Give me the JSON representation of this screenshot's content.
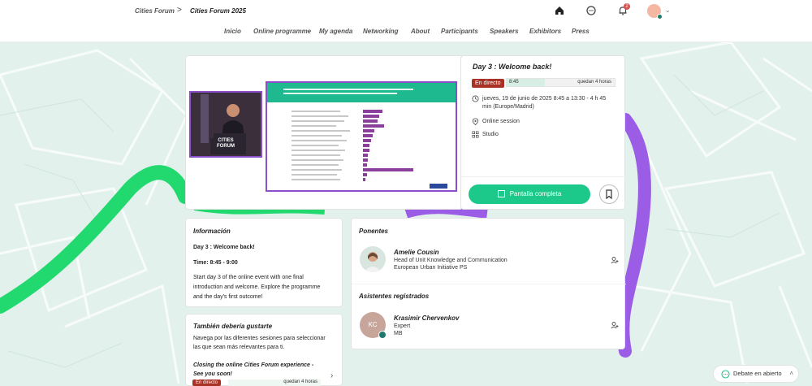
{
  "header": {
    "breadcrumb_parent": "Cities Forum",
    "breadcrumb_sep": ">",
    "breadcrumb_current": "Cities Forum 2025",
    "notification_count": "2",
    "nav": [
      "Inicio",
      "Online programme",
      "My agenda",
      "Networking",
      "About",
      "Participants",
      "Speakers",
      "Exhibitors",
      "Press"
    ]
  },
  "event": {
    "title": "Day 3 : Welcome back!",
    "live_label": "En directo",
    "start": "8:45",
    "remaining": "quedan 4 horas",
    "progress": 0.35,
    "date_line1": "jueves, 19 de junio de 2025 8:45 a 13:30 - 4 h 45",
    "date_line2": "min (Europe/Madrid)",
    "session_type": "Online session",
    "room": "Studio",
    "fullscreen_label": "Pantalla completa"
  },
  "information": {
    "title": "Información",
    "line1": "Day 3 : Welcome back!",
    "line2": "Time: 8:45 - 9:00",
    "body1": "Start day 3 of the online event with one final",
    "body2": "introduction and welcome. Explore the programme",
    "body3": "and the day's first outcome!"
  },
  "also_like": {
    "title": "También debería gustarte",
    "desc1": "Navega por las diferentes sesiones para seleccionar",
    "desc2": "las que sean más relevantes para ti.",
    "item_title1": "Closing the online Cities Forum experience -",
    "item_title2": "See you soon!",
    "item_live": "En directo",
    "item_remaining": "quedan 4 horas"
  },
  "speakers": {
    "title": "Ponentes",
    "items": [
      {
        "name": "Amelie Cousin",
        "role": "Head of Unit Knowledge and Communication",
        "org": "European Urban Initiative PS"
      }
    ]
  },
  "attendees": {
    "title": "Asistentes registrados",
    "items": [
      {
        "initials": "KC",
        "name": "Krasimir Chervenkov",
        "role": "Expert",
        "org": "MB"
      }
    ]
  },
  "video": {
    "banner_line1": "CITIES",
    "banner_line2": "FORUM"
  },
  "chat": {
    "label": "Debate en abierto"
  },
  "colors": {
    "accent_green": "#1dc98a",
    "live_red": "#a83226",
    "purple": "#8a4fc9"
  }
}
